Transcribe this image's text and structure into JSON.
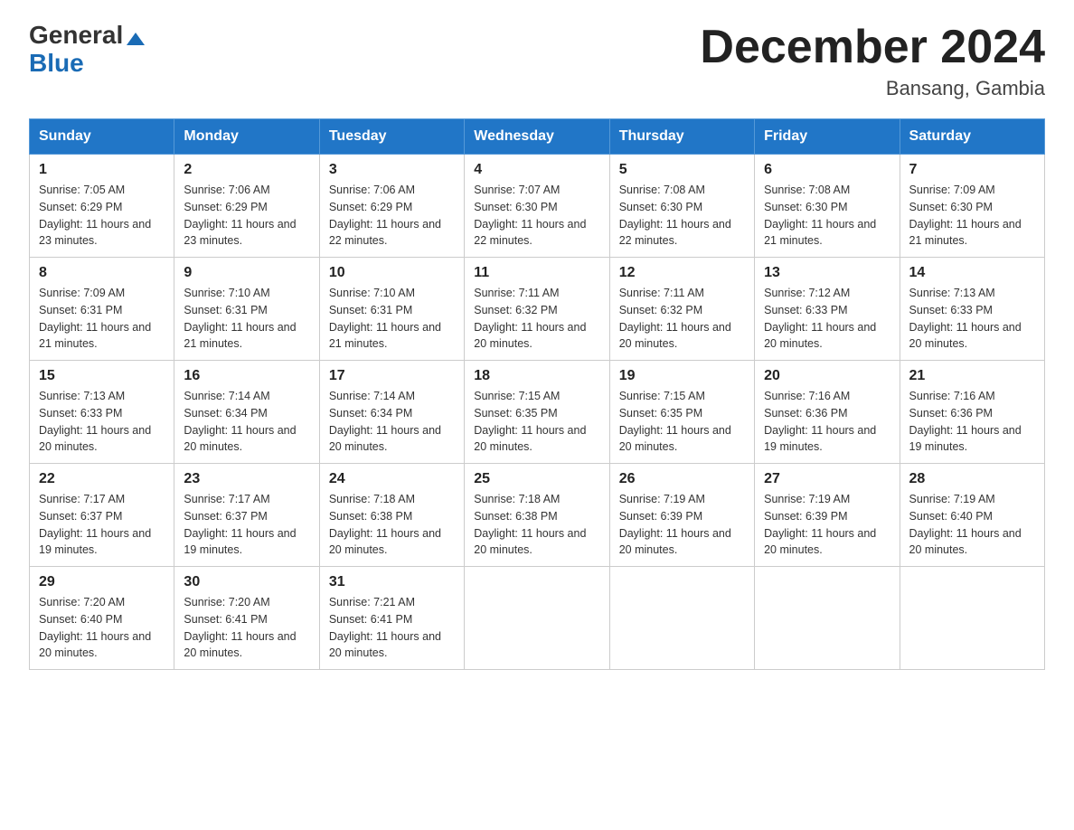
{
  "logo": {
    "general": "General",
    "blue": "Blue",
    "tagline": ""
  },
  "title": "December 2024",
  "subtitle": "Bansang, Gambia",
  "headers": [
    "Sunday",
    "Monday",
    "Tuesday",
    "Wednesday",
    "Thursday",
    "Friday",
    "Saturday"
  ],
  "weeks": [
    [
      {
        "day": "1",
        "sunrise": "Sunrise: 7:05 AM",
        "sunset": "Sunset: 6:29 PM",
        "daylight": "Daylight: 11 hours and 23 minutes."
      },
      {
        "day": "2",
        "sunrise": "Sunrise: 7:06 AM",
        "sunset": "Sunset: 6:29 PM",
        "daylight": "Daylight: 11 hours and 23 minutes."
      },
      {
        "day": "3",
        "sunrise": "Sunrise: 7:06 AM",
        "sunset": "Sunset: 6:29 PM",
        "daylight": "Daylight: 11 hours and 22 minutes."
      },
      {
        "day": "4",
        "sunrise": "Sunrise: 7:07 AM",
        "sunset": "Sunset: 6:30 PM",
        "daylight": "Daylight: 11 hours and 22 minutes."
      },
      {
        "day": "5",
        "sunrise": "Sunrise: 7:08 AM",
        "sunset": "Sunset: 6:30 PM",
        "daylight": "Daylight: 11 hours and 22 minutes."
      },
      {
        "day": "6",
        "sunrise": "Sunrise: 7:08 AM",
        "sunset": "Sunset: 6:30 PM",
        "daylight": "Daylight: 11 hours and 21 minutes."
      },
      {
        "day": "7",
        "sunrise": "Sunrise: 7:09 AM",
        "sunset": "Sunset: 6:30 PM",
        "daylight": "Daylight: 11 hours and 21 minutes."
      }
    ],
    [
      {
        "day": "8",
        "sunrise": "Sunrise: 7:09 AM",
        "sunset": "Sunset: 6:31 PM",
        "daylight": "Daylight: 11 hours and 21 minutes."
      },
      {
        "day": "9",
        "sunrise": "Sunrise: 7:10 AM",
        "sunset": "Sunset: 6:31 PM",
        "daylight": "Daylight: 11 hours and 21 minutes."
      },
      {
        "day": "10",
        "sunrise": "Sunrise: 7:10 AM",
        "sunset": "Sunset: 6:31 PM",
        "daylight": "Daylight: 11 hours and 21 minutes."
      },
      {
        "day": "11",
        "sunrise": "Sunrise: 7:11 AM",
        "sunset": "Sunset: 6:32 PM",
        "daylight": "Daylight: 11 hours and 20 minutes."
      },
      {
        "day": "12",
        "sunrise": "Sunrise: 7:11 AM",
        "sunset": "Sunset: 6:32 PM",
        "daylight": "Daylight: 11 hours and 20 minutes."
      },
      {
        "day": "13",
        "sunrise": "Sunrise: 7:12 AM",
        "sunset": "Sunset: 6:33 PM",
        "daylight": "Daylight: 11 hours and 20 minutes."
      },
      {
        "day": "14",
        "sunrise": "Sunrise: 7:13 AM",
        "sunset": "Sunset: 6:33 PM",
        "daylight": "Daylight: 11 hours and 20 minutes."
      }
    ],
    [
      {
        "day": "15",
        "sunrise": "Sunrise: 7:13 AM",
        "sunset": "Sunset: 6:33 PM",
        "daylight": "Daylight: 11 hours and 20 minutes."
      },
      {
        "day": "16",
        "sunrise": "Sunrise: 7:14 AM",
        "sunset": "Sunset: 6:34 PM",
        "daylight": "Daylight: 11 hours and 20 minutes."
      },
      {
        "day": "17",
        "sunrise": "Sunrise: 7:14 AM",
        "sunset": "Sunset: 6:34 PM",
        "daylight": "Daylight: 11 hours and 20 minutes."
      },
      {
        "day": "18",
        "sunrise": "Sunrise: 7:15 AM",
        "sunset": "Sunset: 6:35 PM",
        "daylight": "Daylight: 11 hours and 20 minutes."
      },
      {
        "day": "19",
        "sunrise": "Sunrise: 7:15 AM",
        "sunset": "Sunset: 6:35 PM",
        "daylight": "Daylight: 11 hours and 20 minutes."
      },
      {
        "day": "20",
        "sunrise": "Sunrise: 7:16 AM",
        "sunset": "Sunset: 6:36 PM",
        "daylight": "Daylight: 11 hours and 19 minutes."
      },
      {
        "day": "21",
        "sunrise": "Sunrise: 7:16 AM",
        "sunset": "Sunset: 6:36 PM",
        "daylight": "Daylight: 11 hours and 19 minutes."
      }
    ],
    [
      {
        "day": "22",
        "sunrise": "Sunrise: 7:17 AM",
        "sunset": "Sunset: 6:37 PM",
        "daylight": "Daylight: 11 hours and 19 minutes."
      },
      {
        "day": "23",
        "sunrise": "Sunrise: 7:17 AM",
        "sunset": "Sunset: 6:37 PM",
        "daylight": "Daylight: 11 hours and 19 minutes."
      },
      {
        "day": "24",
        "sunrise": "Sunrise: 7:18 AM",
        "sunset": "Sunset: 6:38 PM",
        "daylight": "Daylight: 11 hours and 20 minutes."
      },
      {
        "day": "25",
        "sunrise": "Sunrise: 7:18 AM",
        "sunset": "Sunset: 6:38 PM",
        "daylight": "Daylight: 11 hours and 20 minutes."
      },
      {
        "day": "26",
        "sunrise": "Sunrise: 7:19 AM",
        "sunset": "Sunset: 6:39 PM",
        "daylight": "Daylight: 11 hours and 20 minutes."
      },
      {
        "day": "27",
        "sunrise": "Sunrise: 7:19 AM",
        "sunset": "Sunset: 6:39 PM",
        "daylight": "Daylight: 11 hours and 20 minutes."
      },
      {
        "day": "28",
        "sunrise": "Sunrise: 7:19 AM",
        "sunset": "Sunset: 6:40 PM",
        "daylight": "Daylight: 11 hours and 20 minutes."
      }
    ],
    [
      {
        "day": "29",
        "sunrise": "Sunrise: 7:20 AM",
        "sunset": "Sunset: 6:40 PM",
        "daylight": "Daylight: 11 hours and 20 minutes."
      },
      {
        "day": "30",
        "sunrise": "Sunrise: 7:20 AM",
        "sunset": "Sunset: 6:41 PM",
        "daylight": "Daylight: 11 hours and 20 minutes."
      },
      {
        "day": "31",
        "sunrise": "Sunrise: 7:21 AM",
        "sunset": "Sunset: 6:41 PM",
        "daylight": "Daylight: 11 hours and 20 minutes."
      },
      null,
      null,
      null,
      null
    ]
  ]
}
